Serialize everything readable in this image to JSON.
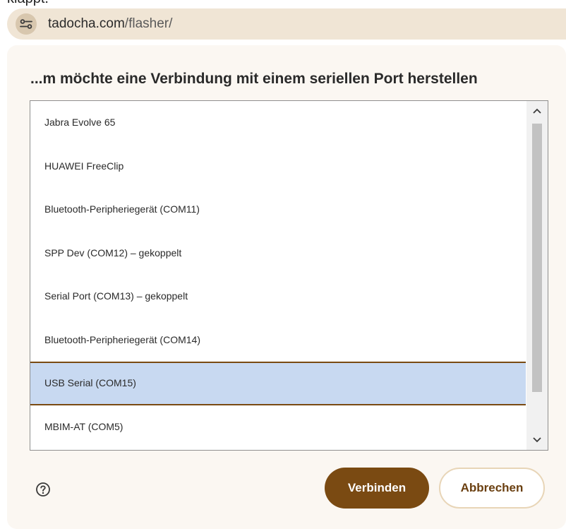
{
  "top_fragment": "klappt.",
  "address_bar": {
    "site_icon": "tune-icon",
    "url_host": "tadocha.com",
    "url_path": "/flasher/"
  },
  "dialog": {
    "title": "...m möchte eine Verbindung mit einem seriellen Port herstellen",
    "ports": [
      {
        "label": "Jabra Evolve 65"
      },
      {
        "label": "HUAWEI FreeClip"
      },
      {
        "label": "Bluetooth-Peripheriegerät (COM11)"
      },
      {
        "label": "SPP Dev (COM12) – gekoppelt"
      },
      {
        "label": "Serial Port (COM13) – gekoppelt"
      },
      {
        "label": "Bluetooth-Peripheriegerät (COM14)"
      },
      {
        "label": "USB Serial (COM15)",
        "selected": true
      },
      {
        "label": "MBIM-AT (COM5)"
      }
    ],
    "help_icon": "help-circle-icon",
    "connect_label": "Verbinden",
    "cancel_label": "Abbrechen"
  },
  "colors": {
    "accent": "#7a4a12",
    "selection": "#c8d9f1",
    "address_bar": "#f0e5d5",
    "dialog_bg": "#fbf7f2"
  }
}
